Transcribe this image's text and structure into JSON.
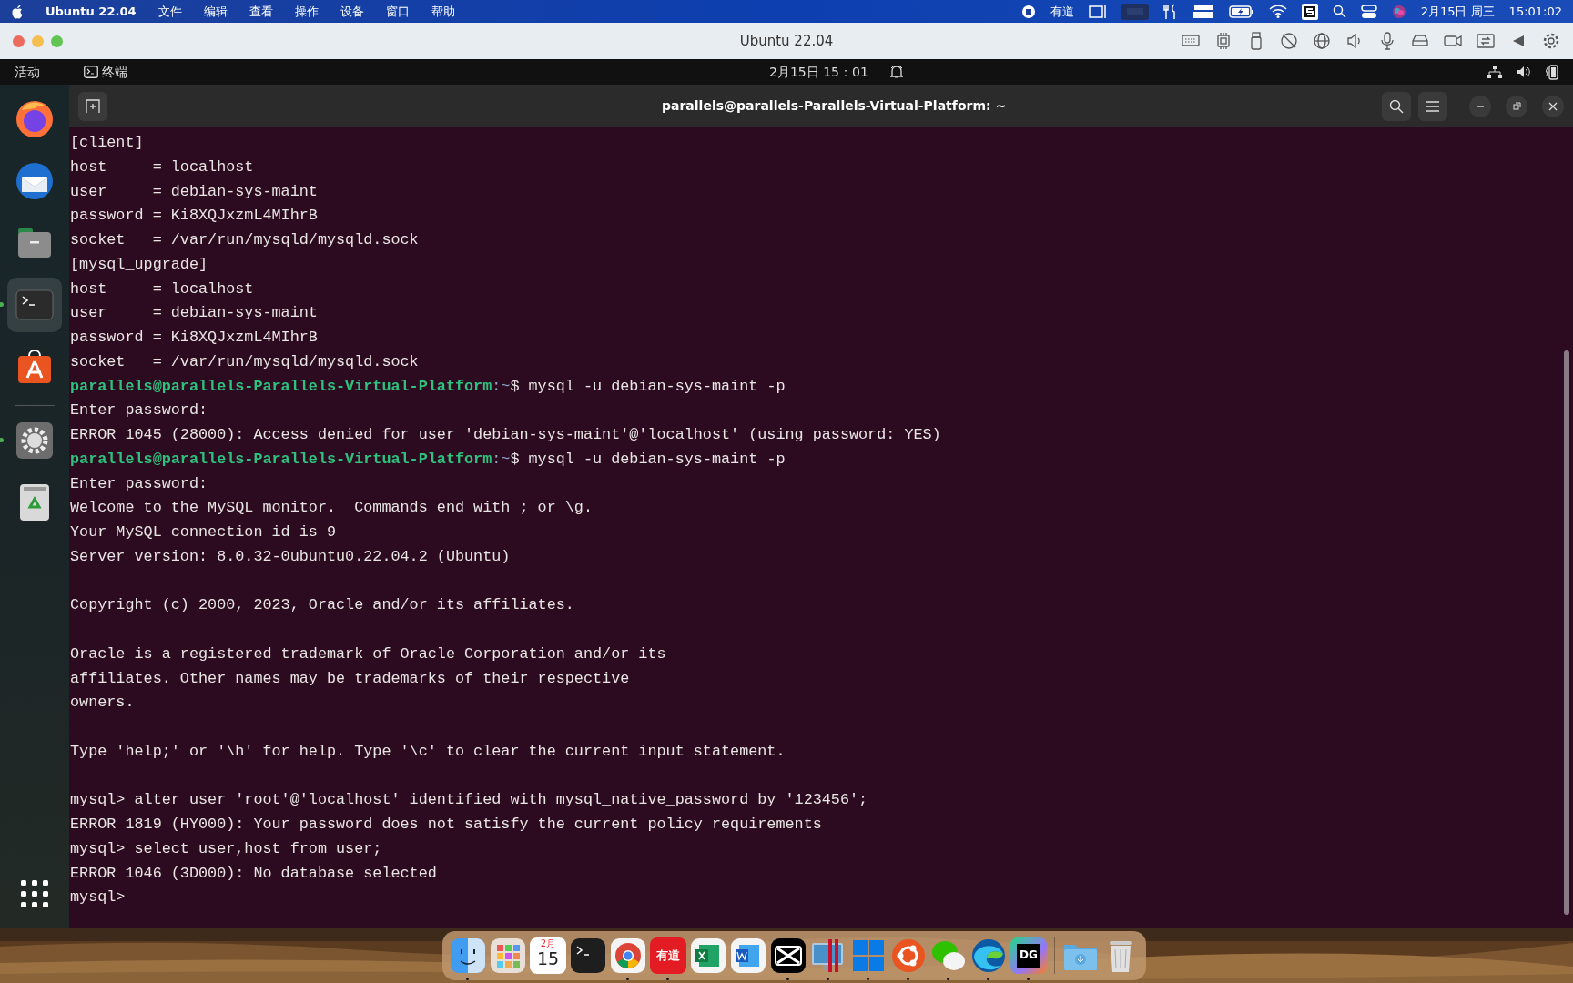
{
  "mac_menu_bar": {
    "app_name": "Ubuntu 22.04",
    "menus": [
      "文件",
      "编辑",
      "查看",
      "操作",
      "设备",
      "窗口",
      "帮助"
    ],
    "status_text": "有道",
    "date": "2月15日 周三",
    "time": "15:01:02"
  },
  "window": {
    "title": "Ubuntu 22.04"
  },
  "ubuntu_top_bar": {
    "activities": "活动",
    "app": "终端",
    "clock": "2月15日 15：01"
  },
  "ubuntu_dock": [
    {
      "kind": "firefox",
      "running": false,
      "selected": false
    },
    {
      "kind": "thunderbird",
      "running": false,
      "selected": false
    },
    {
      "kind": "files",
      "running": false,
      "selected": false
    },
    {
      "kind": "terminal",
      "running": true,
      "selected": true
    },
    {
      "kind": "software",
      "running": false,
      "selected": false
    },
    {
      "kind": "separator"
    },
    {
      "kind": "settings",
      "running": true,
      "selected": false
    },
    {
      "kind": "trash",
      "running": false,
      "selected": false
    }
  ],
  "terminal": {
    "title": "parallels@parallels-Parallels-Virtual-Platform: ~",
    "lines": [
      {
        "kind": "text",
        "text": "[client]"
      },
      {
        "kind": "text",
        "text": "host     = localhost"
      },
      {
        "kind": "text",
        "text": "user     = debian-sys-maint"
      },
      {
        "kind": "text",
        "text": "password = Ki8XQJxzmL4MIhrB"
      },
      {
        "kind": "text",
        "text": "socket   = /var/run/mysqld/mysqld.sock"
      },
      {
        "kind": "text",
        "text": "[mysql_upgrade]"
      },
      {
        "kind": "text",
        "text": "host     = localhost"
      },
      {
        "kind": "text",
        "text": "user     = debian-sys-maint"
      },
      {
        "kind": "text",
        "text": "password = Ki8XQJxzmL4MIhrB"
      },
      {
        "kind": "text",
        "text": "socket   = /var/run/mysqld/mysqld.sock"
      },
      {
        "kind": "prompt",
        "user_host": "parallels@parallels-Parallels-Virtual-Platform",
        "path": ":~",
        "command": "$ mysql -u debian-sys-maint -p"
      },
      {
        "kind": "text",
        "text": "Enter password:"
      },
      {
        "kind": "text",
        "text": "ERROR 1045 (28000): Access denied for user 'debian-sys-maint'@'localhost' (using password: YES)"
      },
      {
        "kind": "prompt",
        "user_host": "parallels@parallels-Parallels-Virtual-Platform",
        "path": ":~",
        "command": "$ mysql -u debian-sys-maint -p"
      },
      {
        "kind": "text",
        "text": "Enter password:"
      },
      {
        "kind": "text",
        "text": "Welcome to the MySQL monitor.  Commands end with ; or \\g."
      },
      {
        "kind": "text",
        "text": "Your MySQL connection id is 9"
      },
      {
        "kind": "text",
        "text": "Server version: 8.0.32-0ubuntu0.22.04.2 (Ubuntu)"
      },
      {
        "kind": "blank"
      },
      {
        "kind": "text",
        "text": "Copyright (c) 2000, 2023, Oracle and/or its affiliates."
      },
      {
        "kind": "blank"
      },
      {
        "kind": "text",
        "text": "Oracle is a registered trademark of Oracle Corporation and/or its"
      },
      {
        "kind": "text",
        "text": "affiliates. Other names may be trademarks of their respective"
      },
      {
        "kind": "text",
        "text": "owners."
      },
      {
        "kind": "blank"
      },
      {
        "kind": "text",
        "text": "Type 'help;' or '\\h' for help. Type '\\c' to clear the current input statement."
      },
      {
        "kind": "blank"
      },
      {
        "kind": "text",
        "text": "mysql> alter user 'root'@'localhost' identified with mysql_native_password by '123456';"
      },
      {
        "kind": "text",
        "text": "ERROR 1819 (HY000): Your password does not satisfy the current policy requirements"
      },
      {
        "kind": "text",
        "text": "mysql> select user,host from user;"
      },
      {
        "kind": "text",
        "text": "ERROR 1046 (3D000): No database selected"
      },
      {
        "kind": "text",
        "text": "mysql>"
      }
    ]
  },
  "mac_dock": [
    {
      "kind": "finder",
      "running": true
    },
    {
      "kind": "launchpad",
      "running": false
    },
    {
      "kind": "calendar",
      "month": "2月",
      "day": "15",
      "running": false
    },
    {
      "kind": "terminal",
      "running": false
    },
    {
      "kind": "chrome",
      "running": true
    },
    {
      "kind": "youdao",
      "label": "有道",
      "running": true
    },
    {
      "kind": "excel",
      "running": false
    },
    {
      "kind": "word",
      "running": false
    },
    {
      "kind": "capcut",
      "running": true
    },
    {
      "kind": "parallels",
      "running": true
    },
    {
      "kind": "windows",
      "running": true
    },
    {
      "kind": "ubuntu",
      "running": true
    },
    {
      "kind": "wechat",
      "running": true
    },
    {
      "kind": "edge",
      "running": true
    },
    {
      "kind": "datagrip",
      "label": "DG",
      "running": true
    },
    {
      "kind": "separator"
    },
    {
      "kind": "downloads",
      "running": false
    },
    {
      "kind": "trash",
      "running": false
    }
  ]
}
